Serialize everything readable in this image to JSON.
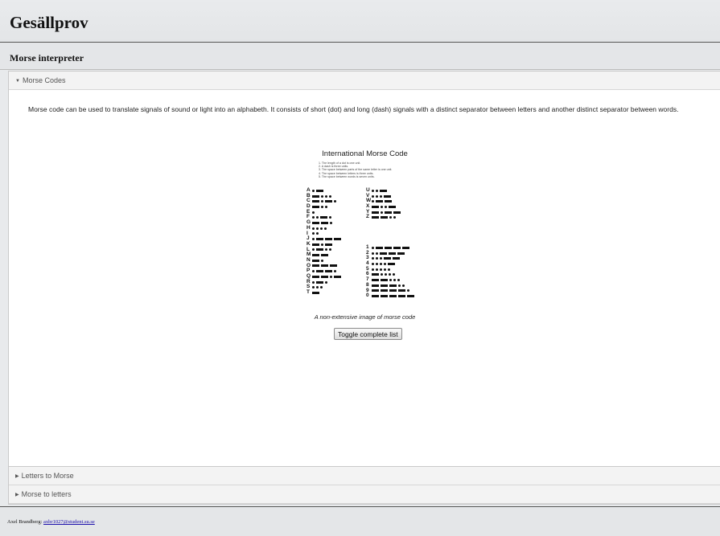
{
  "site": {
    "title": "Gesällprov"
  },
  "section": {
    "title": "Morse interpreter"
  },
  "accordion": {
    "sections": [
      {
        "label": "Morse Codes",
        "expanded": true
      },
      {
        "label": "Letters to Morse",
        "expanded": false
      },
      {
        "label": "Morse to letters",
        "expanded": false
      }
    ]
  },
  "morse_codes": {
    "intro": "Morse code can be used to translate signals of sound or light into an alphabeth. It consists of short (dot) and long (dash) signals with a distinct separator between letters and another distinct separator between words.",
    "image": {
      "title": "International Morse Code",
      "rules": [
        "1. The length of a dot is one unit.",
        "2. A dash is three units.",
        "3. The space between parts of the same letter is one unit.",
        "4. The space between letters is three units.",
        "5. The space between words is seven units."
      ],
      "codes": {
        "letters_a_to_t": [
          [
            "A",
            ".-"
          ],
          [
            "B",
            "-..."
          ],
          [
            "C",
            "-.-."
          ],
          [
            "D",
            "-.."
          ],
          [
            "E",
            "."
          ],
          [
            "F",
            "..-."
          ],
          [
            "G",
            "--."
          ],
          [
            "H",
            "...."
          ],
          [
            "I",
            ".."
          ],
          [
            "J",
            ".---"
          ],
          [
            "K",
            "-.-"
          ],
          [
            "L",
            ".-.."
          ],
          [
            "M",
            "--"
          ],
          [
            "N",
            "-."
          ],
          [
            "O",
            "---"
          ],
          [
            "P",
            ".--."
          ],
          [
            "Q",
            "--.-"
          ],
          [
            "R",
            ".-."
          ],
          [
            "S",
            "..."
          ],
          [
            "T",
            "-"
          ]
        ],
        "letters_u_to_z": [
          [
            "U",
            "..-"
          ],
          [
            "V",
            "...-"
          ],
          [
            "W",
            ".--"
          ],
          [
            "X",
            "-..-"
          ],
          [
            "Y",
            "-.--"
          ],
          [
            "Z",
            "--.."
          ]
        ],
        "digits": [
          [
            "1",
            ".----"
          ],
          [
            "2",
            "..---"
          ],
          [
            "3",
            "...--"
          ],
          [
            "4",
            "....-"
          ],
          [
            "5",
            "....."
          ],
          [
            "6",
            "-...."
          ],
          [
            "7",
            "--..."
          ],
          [
            "8",
            "---.."
          ],
          [
            "9",
            "----."
          ],
          [
            "0",
            "-----"
          ]
        ]
      }
    },
    "caption": "A non-extensive image of morse code",
    "toggle_label": "Toggle complete list"
  },
  "footer": {
    "author": "Axel Brandberg:",
    "email": "axbr1027@student.su.se"
  },
  "colors": {
    "header_bg": "#e9ebed",
    "link": "#1a0dab",
    "panel_border": "#c9c9c9"
  }
}
